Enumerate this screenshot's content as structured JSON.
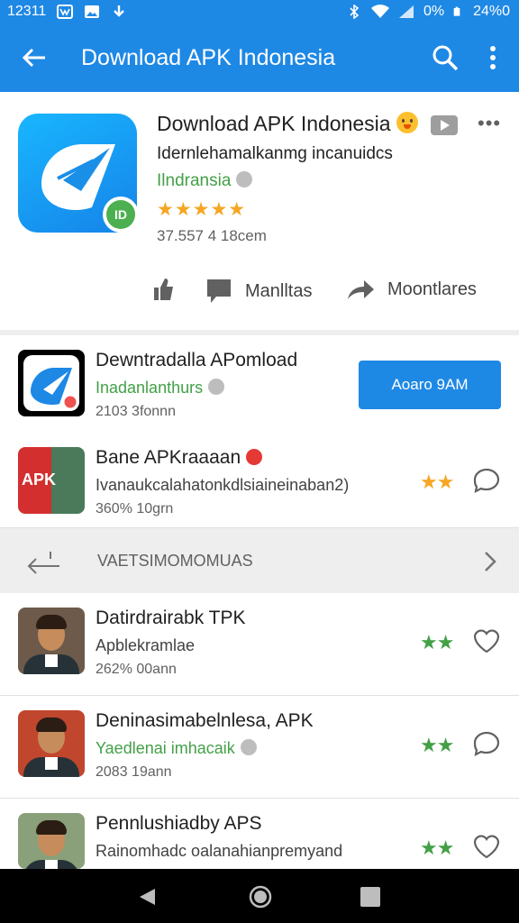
{
  "status_bar": {
    "time": "12311",
    "battery_pct": "0%",
    "battery_alt": "24%0"
  },
  "app_bar": {
    "title": "Download APK Indonesia"
  },
  "header": {
    "title": "Download APK Indonesia",
    "subtitle": "Idernlehamalkanmg incanuidcs",
    "developer": "Ilndransia",
    "badge": "ID",
    "rating_stars": "★★★★★",
    "meta": "37.557  4 18cem",
    "action_like": "",
    "action_share_label": "Manlltas",
    "action_forward_label": "Moontlares"
  },
  "list_top": [
    {
      "title": "Dewntradalla APomload",
      "subtitle": "Inadanlanthurs",
      "meta": "2103  3fonnn",
      "button": "Aoaro 9AM",
      "icon": "app-logo-icon"
    },
    {
      "title": "Bane APKraaaan",
      "subtitle": "Ivanaukcalahatonkdlsiaineinaban2)",
      "meta": "360%  10grn",
      "stars": "★★",
      "icon": "apk-thumbnail-icon",
      "thumb_text": "APK"
    }
  ],
  "section": {
    "title": "VAETSIMOMOMUAS"
  },
  "list_bottom": [
    {
      "title": "Datirdrairabk TPK",
      "subtitle": "Apblekramlae",
      "meta": "262%  00ann",
      "stars": "★★"
    },
    {
      "title": "Deninasimabelnlesa, APK",
      "subtitle": "Yaedlenai imhacaik",
      "meta": "2083  19ann",
      "stars": "★★"
    },
    {
      "title": "Pennlushiadby APS",
      "subtitle": "Rainomhadc oalanahianpremyand",
      "meta": "",
      "stars": "★★"
    }
  ],
  "colors": {
    "primary": "#1e88e5",
    "green": "#43a047",
    "star_orange": "#f5a623"
  }
}
